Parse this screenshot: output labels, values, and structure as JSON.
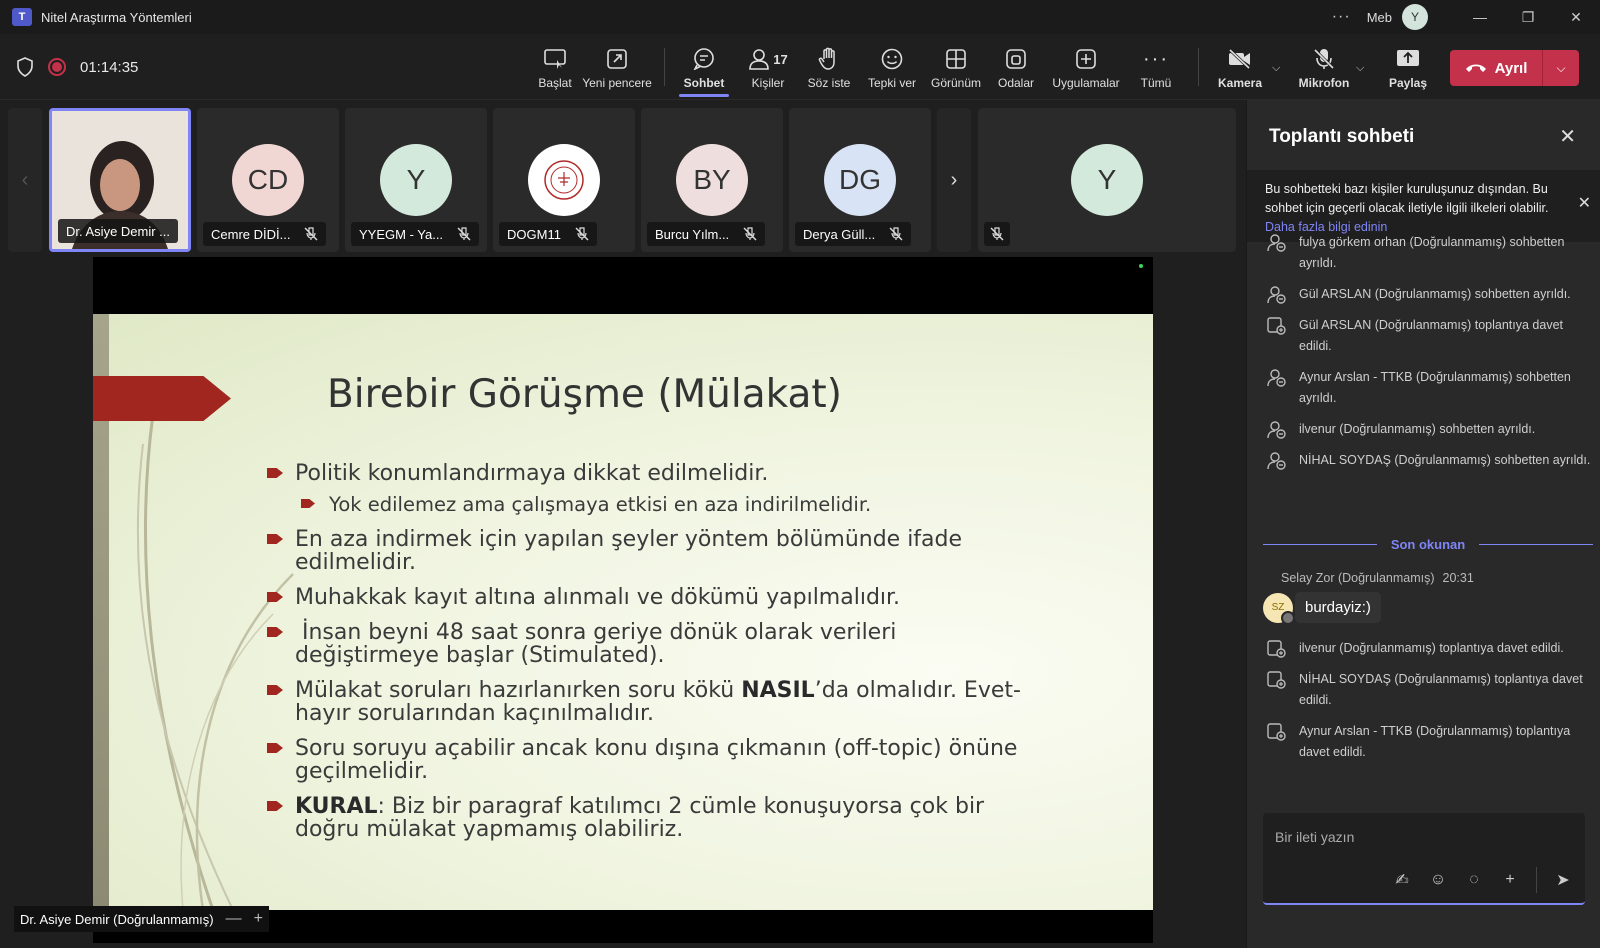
{
  "window": {
    "title": "Nitel Araştırma Yöntemleri",
    "user": "Meb",
    "user_initial": "Y"
  },
  "toolbar": {
    "timer": "01:14:35",
    "buttons": {
      "start": "Başlat",
      "new_window": "Yeni pencere",
      "chat": "Sohbet",
      "people": "Kişiler",
      "people_count": "17",
      "raise_hand": "Söz iste",
      "react": "Tepki ver",
      "view": "Görünüm",
      "rooms": "Odalar",
      "apps": "Uygulamalar",
      "more": "Tümü",
      "camera": "Kamera",
      "mic": "Mikrofon",
      "share": "Paylaş",
      "leave": "Ayrıl"
    },
    "accent": "#7f85f5",
    "leave_color": "#c4314b"
  },
  "participants": [
    {
      "name": "Dr. Asiye Demir ...",
      "initials": "",
      "bg": "#ece7e2",
      "video": true
    },
    {
      "name": "Cemre DİDİ...",
      "initials": "CD",
      "bg": "#f0d7d4"
    },
    {
      "name": "YYEGM - Ya...",
      "initials": "Y",
      "bg": "#d3e9dc"
    },
    {
      "name": "DOGM11",
      "initials": "",
      "bg": "#ffffff",
      "logo": true
    },
    {
      "name": "Burcu Yılm...",
      "initials": "BY",
      "bg": "#efdede"
    },
    {
      "name": "Derya Güll...",
      "initials": "DG",
      "bg": "#d8e3f5"
    },
    {
      "name": "",
      "initials": "Y",
      "bg": "#d3e9dc"
    }
  ],
  "slide": {
    "title": "Birebir Görüşme (Mülakat)",
    "bullets": [
      {
        "text": "Politik konumlandırmaya dikkat edilmelidir.",
        "level": 1
      },
      {
        "text": "Yok edilemez ama çalışmaya etkisi en aza indirilmelidir.",
        "level": 2
      },
      {
        "text": "En aza indirmek için yapılan şeyler yöntem bölümünde ifade edilmelidir.",
        "level": 1
      },
      {
        "text": "Muhakkak kayıt altına alınmalı ve dökümü yapılmalıdır.",
        "level": 1
      },
      {
        "text": " İnsan beyni 48 saat sonra geriye dönük olarak verileri değiştirmeye başlar (Stimulated).",
        "level": 1
      },
      {
        "pre": "Mülakat soruları hazırlanırken soru kökü ",
        "bold": "NASIL",
        "post": "’da olmalıdır. Evet-hayır sorularından kaçınılmalıdır.",
        "level": 1
      },
      {
        "text": "Soru soruyu açabilir ancak konu dışına çıkmanın (off-topic) önüne geçilmelidir.",
        "level": 1
      },
      {
        "pre": "",
        "bold": "KURAL",
        "post": ": Biz bir paragraf katılımcı 2 cümle konuşuyorsa çok bir doğru mülakat yapmamış olabiliriz.",
        "level": 1
      }
    ],
    "presenter": "Dr. Asiye Demir (Doğrulanmamış)"
  },
  "chat": {
    "title": "Toplantı sohbeti",
    "notice": "Bu sohbetteki bazı kişiler kuruluşunuz dışından. Bu sohbet için geçerli olacak iletiyle ilgili ilkeleri olabilir.",
    "notice_link": "Daha fazla bilgi edinin",
    "events": [
      "fulya görkem orhan (Doğrulanmamış) sohbetten ayrıldı.",
      "Gül ARSLAN (Doğrulanmamış) sohbetten ayrıldı.",
      "Gül ARSLAN (Doğrulanmamış) toplantıya davet edildi.",
      "Aynur Arslan - TTKB (Doğrulanmamış) sohbetten ayrıldı.",
      "ilvenur (Doğrulanmamış) sohbetten ayrıldı.",
      "NİHAL SOYDAŞ (Doğrulanmamış) sohbetten ayrıldı."
    ],
    "last_read": "Son okunan",
    "message": {
      "author": "Selay Zor (Doğrulanmamış)",
      "time": "20:31",
      "initials": "SZ",
      "text": "burdayiz:)"
    },
    "events2": [
      "ilvenur (Doğrulanmamış) toplantıya davet edildi.",
      "NİHAL SOYDAŞ (Doğrulanmamış) toplantıya davet edildi.",
      "Aynur Arslan - TTKB (Doğrulanmamış) toplantıya davet edildi."
    ],
    "composer_placeholder": "Bir ileti yazın"
  }
}
